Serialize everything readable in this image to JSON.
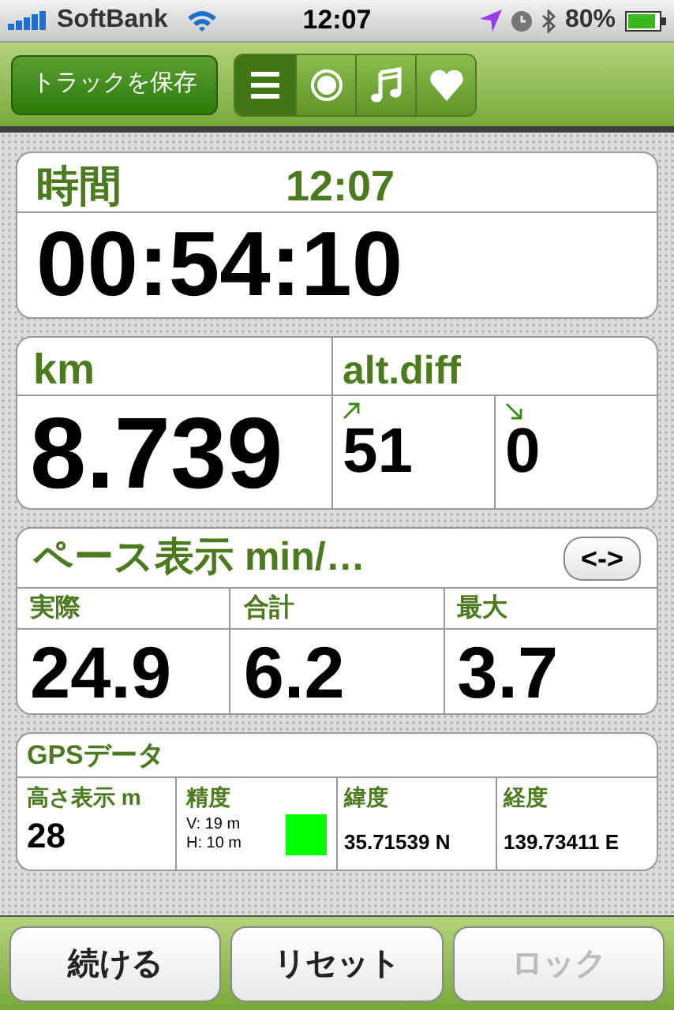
{
  "status_bar": {
    "carrier": "SoftBank",
    "time": "12:07",
    "battery": "80%"
  },
  "toolbar": {
    "save_button": "トラックを保存",
    "segments": [
      {
        "kind": "list",
        "selected": true
      },
      {
        "kind": "record",
        "selected": false
      },
      {
        "kind": "music",
        "selected": false
      },
      {
        "kind": "heart",
        "selected": false
      }
    ]
  },
  "time_card": {
    "title": "時間",
    "clock": "12:07",
    "elapsed": "00:54:10"
  },
  "distance_card": {
    "title": "km",
    "value": "8.739"
  },
  "altitude_card": {
    "title": "alt.diff",
    "ascent": "51",
    "descent": "0"
  },
  "pace_card": {
    "title": "ペース表示 min/…",
    "toggle": "<->",
    "columns": [
      {
        "label": "実際",
        "value": "24.9"
      },
      {
        "label": "合計",
        "value": "6.2"
      },
      {
        "label": "最大",
        "value": "3.7"
      }
    ]
  },
  "gps_card": {
    "title": "GPSデータ",
    "altitude": {
      "label": "高さ表示 m",
      "value": "28"
    },
    "accuracy": {
      "label": "精度",
      "vertical": "V: 19 m",
      "horizontal": "H: 10 m",
      "color": "#00ff00"
    },
    "latitude": {
      "label": "緯度",
      "value": "35.71539 N"
    },
    "longitude": {
      "label": "経度",
      "value": "139.73411 E"
    }
  },
  "buttons": [
    {
      "label": "続ける",
      "disabled": false
    },
    {
      "label": "リセット",
      "disabled": false
    },
    {
      "label": "ロック",
      "disabled": true
    }
  ]
}
